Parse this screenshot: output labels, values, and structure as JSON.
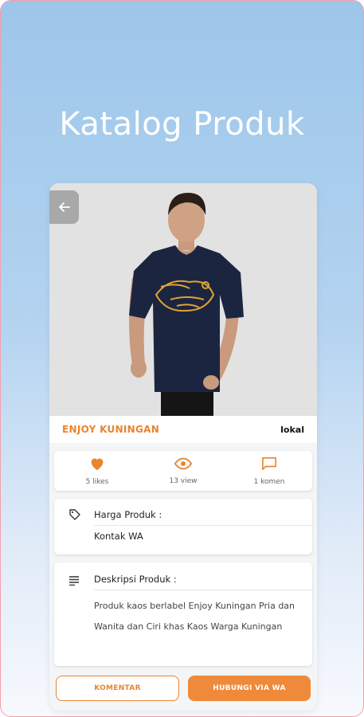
{
  "header": {
    "title": "Katalog Produk"
  },
  "product": {
    "name": "ENJOY KUNINGAN",
    "origin": "lokal",
    "shirt_print": "Enjoy Kuningan"
  },
  "stats": {
    "likes": "5 likes",
    "views": "13 view",
    "comments": "1 komen"
  },
  "price": {
    "heading": "Harga Produk :",
    "value": "Kontak WA"
  },
  "description": {
    "heading": "Deskripsi Produk :",
    "text": "Produk kaos berlabel Enjoy Kuningan Pria dan Wanita dan Ciri khas Kaos Warga Kuningan"
  },
  "actions": {
    "comment": "KOMENTAR",
    "contact": "HUBUNGI VIA WA"
  },
  "colors": {
    "accent": "#e8852d",
    "button": "#ee8a3a",
    "background_top": "#9dc6ea"
  },
  "icons": [
    "back-arrow-icon",
    "heart-icon",
    "eye-icon",
    "comment-icon",
    "tag-icon",
    "notes-icon"
  ]
}
